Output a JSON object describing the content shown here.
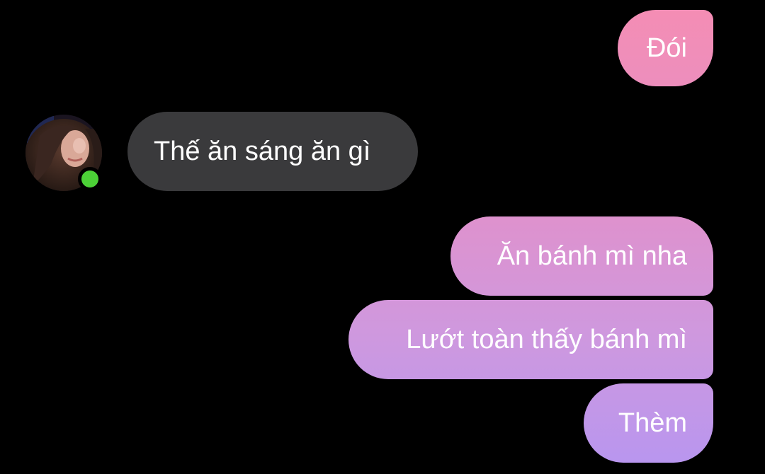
{
  "messages": [
    {
      "sender": "me",
      "text": "Đói"
    },
    {
      "sender": "contact",
      "text": "Thế ăn sáng ăn gì"
    },
    {
      "sender": "me",
      "text": "Ăn bánh mì nha"
    },
    {
      "sender": "me",
      "text": "Lướt toàn thấy bánh mì"
    },
    {
      "sender": "me",
      "text": "Thèm"
    }
  ],
  "contact": {
    "avatar": "profile-photo",
    "status": "online",
    "status_color": "#4cd137"
  },
  "colors": {
    "background": "#000000",
    "incoming_bubble": "#3a3a3c",
    "outgoing_gradient": [
      "#f58db3",
      "#e58fc6",
      "#cf98de",
      "#b796f0"
    ],
    "text": "#ffffff"
  }
}
